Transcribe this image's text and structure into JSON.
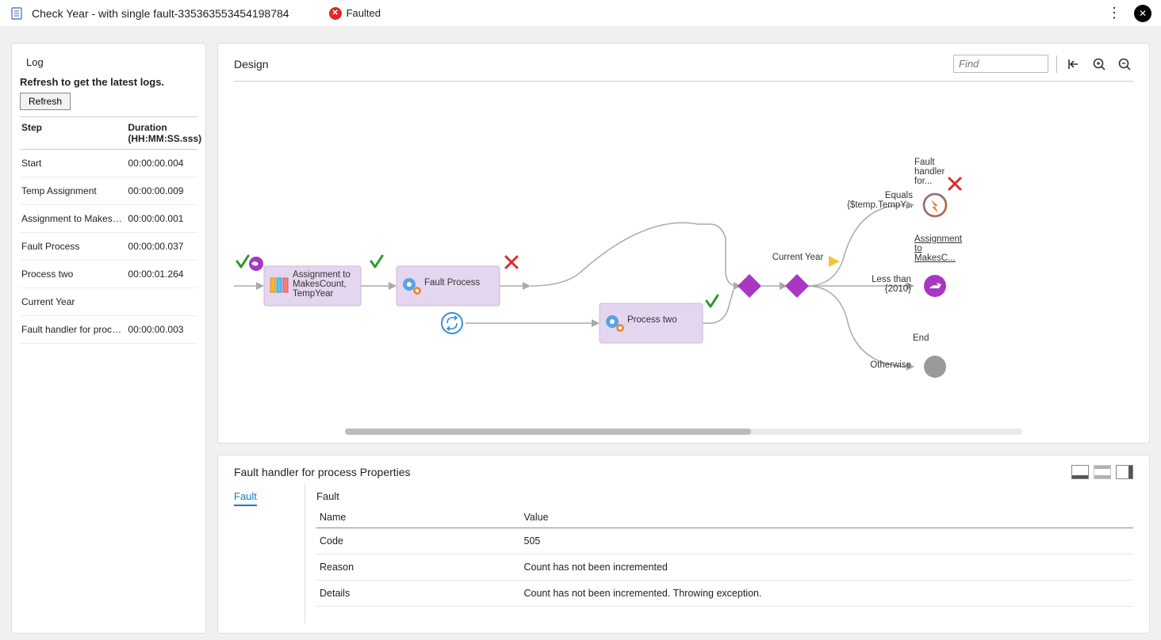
{
  "header": {
    "title": "Check Year - with single fault-335363553454198784",
    "status_text": "Faulted"
  },
  "log": {
    "heading": "Log",
    "refresh_msg": "Refresh to get the latest logs.",
    "refresh_btn": "Refresh",
    "col_step": "Step",
    "col_duration": "Duration (HH:MM:SS.sss)",
    "rows": [
      {
        "step": "Start",
        "dur": "00:00:00.004"
      },
      {
        "step": "Temp Assignment",
        "dur": "00:00:00.009"
      },
      {
        "step": "Assignment to MakesC...",
        "dur": "00:00:00.001"
      },
      {
        "step": "Fault Process",
        "dur": "00:00:00.037"
      },
      {
        "step": "Process two",
        "dur": "00:00:01.264"
      },
      {
        "step": "Current Year",
        "dur": ""
      },
      {
        "step": "Fault handler for process",
        "dur": "00:00:00.003"
      }
    ]
  },
  "design": {
    "title": "Design",
    "find_placeholder": "Find",
    "nodes": {
      "assignment": "Assignment to MakesCount, TempYear",
      "fault_process": "Fault Process",
      "process_two": "Process two",
      "current_year": "Current Year",
      "equals": "Equals {$temp.TempY...",
      "fault_handler": "Fault handler for...",
      "assignment_makesc": "Assignment to MakesC...",
      "less_than": "Less than {2010}",
      "end": "End",
      "otherwise": "Otherwise"
    }
  },
  "props": {
    "title": "Fault handler for process Properties",
    "tab": "Fault",
    "section": "Fault",
    "col_name": "Name",
    "col_value": "Value",
    "rows": [
      {
        "name": "Code",
        "value": "505"
      },
      {
        "name": "Reason",
        "value": "Count has not been incremented"
      },
      {
        "name": "Details",
        "value": "Count has not been incremented. Throwing exception."
      }
    ]
  }
}
